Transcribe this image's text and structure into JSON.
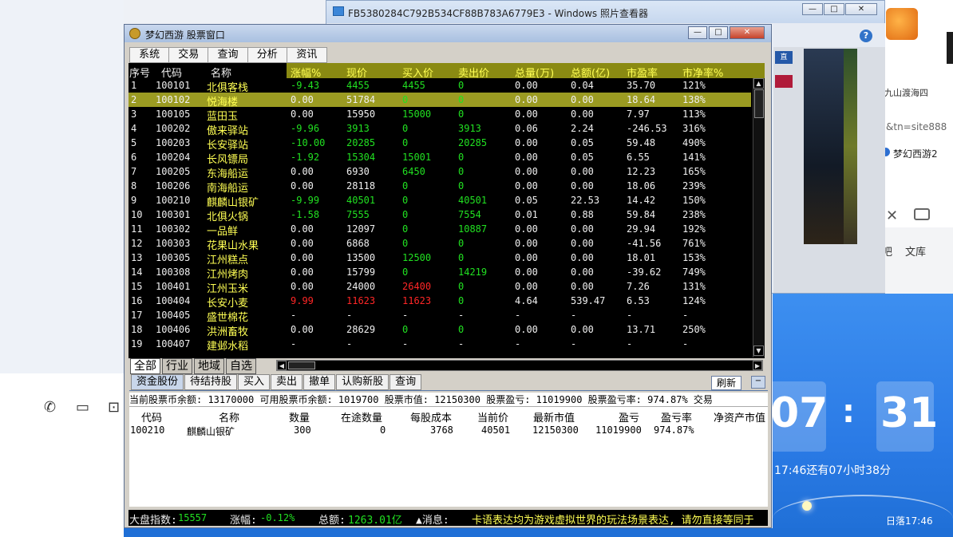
{
  "photo_viewer": {
    "title": "FB5380284C792B534CF88B783A6779E3 - Windows 照片查看器",
    "help": "?",
    "side_chip": "直",
    "buttons": {
      "minimize": "—",
      "maximize": "□",
      "close": "✕"
    }
  },
  "browser_fragment": {
    "url": "&tn=site888",
    "tab": "梦幻西游2",
    "wenku": "文库",
    "ba": "吧",
    "side_text": "九山渡海四"
  },
  "clock": {
    "hour": "07",
    "colon": ":",
    "minute": "31",
    "remaining": "17:46还有07小时38分",
    "sunset": "日落17:46"
  },
  "stock_window": {
    "title": "梦幻西游 股票窗口",
    "menu": [
      "系统",
      "交易",
      "查询",
      "分析",
      "资讯"
    ],
    "columns": {
      "seq": "序号",
      "code": "代码",
      "name": "名称",
      "change": "涨幅%",
      "price": "现价",
      "bid": "买入价",
      "ask": "卖出价",
      "vol": "总量(万)",
      "amount": "总额(亿)",
      "pe": "市盈率",
      "pb": "市净率%"
    },
    "rows": [
      {
        "seq": "1",
        "code": "100101",
        "name": "北俱客栈",
        "change": "-9.43",
        "price": "4455",
        "bid": "4455",
        "ask": "0",
        "vol": "0.00",
        "amount": "0.04",
        "pe": "35.70",
        "pb": "121%",
        "tone": "g"
      },
      {
        "seq": "2",
        "code": "100102",
        "name": "悦海楼",
        "change": "0.00",
        "price": "51784",
        "bid": "0",
        "ask": "0",
        "vol": "0.00",
        "amount": "0.00",
        "pe": "18.64",
        "pb": "138%",
        "tone": "w"
      },
      {
        "seq": "3",
        "code": "100105",
        "name": "蓝田玉",
        "change": "0.00",
        "price": "15950",
        "bid": "15000",
        "ask": "0",
        "vol": "0.00",
        "amount": "0.00",
        "pe": "7.97",
        "pb": "113%",
        "tone": "w"
      },
      {
        "seq": "4",
        "code": "100202",
        "name": "傲来驿站",
        "change": "-9.96",
        "price": "3913",
        "bid": "0",
        "ask": "3913",
        "vol": "0.06",
        "amount": "2.24",
        "pe": "-246.53",
        "pb": "316%",
        "tone": "g"
      },
      {
        "seq": "5",
        "code": "100203",
        "name": "长安驿站",
        "change": "-10.00",
        "price": "20285",
        "bid": "0",
        "ask": "20285",
        "vol": "0.00",
        "amount": "0.05",
        "pe": "59.48",
        "pb": "490%",
        "tone": "g"
      },
      {
        "seq": "6",
        "code": "100204",
        "name": "长风镖局",
        "change": "-1.92",
        "price": "15304",
        "bid": "15001",
        "ask": "0",
        "vol": "0.00",
        "amount": "0.05",
        "pe": "6.55",
        "pb": "141%",
        "tone": "g"
      },
      {
        "seq": "7",
        "code": "100205",
        "name": "东海船运",
        "change": "0.00",
        "price": "6930",
        "bid": "6450",
        "ask": "0",
        "vol": "0.00",
        "amount": "0.00",
        "pe": "12.23",
        "pb": "165%",
        "tone": "w"
      },
      {
        "seq": "8",
        "code": "100206",
        "name": "南海船运",
        "change": "0.00",
        "price": "28118",
        "bid": "0",
        "ask": "0",
        "vol": "0.00",
        "amount": "0.00",
        "pe": "18.06",
        "pb": "239%",
        "tone": "w"
      },
      {
        "seq": "9",
        "code": "100210",
        "name": "麒麟山银矿",
        "change": "-9.99",
        "price": "40501",
        "bid": "0",
        "ask": "40501",
        "vol": "0.05",
        "amount": "22.53",
        "pe": "14.42",
        "pb": "150%",
        "tone": "g"
      },
      {
        "seq": "10",
        "code": "100301",
        "name": "北俱火锅",
        "change": "-1.58",
        "price": "7555",
        "bid": "0",
        "ask": "7554",
        "vol": "0.01",
        "amount": "0.88",
        "pe": "59.84",
        "pb": "238%",
        "tone": "g"
      },
      {
        "seq": "11",
        "code": "100302",
        "name": "一品鲜",
        "change": "0.00",
        "price": "12097",
        "bid": "0",
        "ask": "10887",
        "vol": "0.00",
        "amount": "0.00",
        "pe": "29.94",
        "pb": "192%",
        "tone": "w"
      },
      {
        "seq": "12",
        "code": "100303",
        "name": "花果山水果",
        "change": "0.00",
        "price": "6868",
        "bid": "0",
        "ask": "0",
        "vol": "0.00",
        "amount": "0.00",
        "pe": "-41.56",
        "pb": "761%",
        "tone": "w"
      },
      {
        "seq": "13",
        "code": "100305",
        "name": "江州糕点",
        "change": "0.00",
        "price": "13500",
        "bid": "12500",
        "ask": "0",
        "vol": "0.00",
        "amount": "0.00",
        "pe": "18.01",
        "pb": "153%",
        "tone": "w"
      },
      {
        "seq": "14",
        "code": "100308",
        "name": "江州烤肉",
        "change": "0.00",
        "price": "15799",
        "bid": "0",
        "ask": "14219",
        "vol": "0.00",
        "amount": "0.00",
        "pe": "-39.62",
        "pb": "749%",
        "tone": "w"
      },
      {
        "seq": "15",
        "code": "100401",
        "name": "江州玉米",
        "change": "0.00",
        "price": "24000",
        "bid": "26400",
        "ask": "0",
        "vol": "0.00",
        "amount": "0.00",
        "pe": "7.26",
        "pb": "131%",
        "tone": "w",
        "bid_red": true
      },
      {
        "seq": "16",
        "code": "100404",
        "name": "长安小麦",
        "change": "9.99",
        "price": "11623",
        "bid": "11623",
        "ask": "0",
        "vol": "4.64",
        "amount": "539.47",
        "pe": "6.53",
        "pb": "124%",
        "tone": "r"
      },
      {
        "seq": "17",
        "code": "100405",
        "name": "盛世棉花",
        "change": "-",
        "price": "-",
        "bid": "-",
        "ask": "-",
        "vol": "-",
        "amount": "-",
        "pe": "-",
        "pb": "-",
        "tone": "w"
      },
      {
        "seq": "18",
        "code": "100406",
        "name": "洪洲畜牧",
        "change": "0.00",
        "price": "28629",
        "bid": "0",
        "ask": "0",
        "vol": "0.00",
        "amount": "0.00",
        "pe": "13.71",
        "pb": "250%",
        "tone": "w"
      },
      {
        "seq": "19",
        "code": "100407",
        "name": "建邺水稻",
        "change": "-",
        "price": "-",
        "bid": "-",
        "ask": "-",
        "vol": "-",
        "amount": "-",
        "pe": "-",
        "pb": "-",
        "tone": "w"
      }
    ],
    "selected_row": 2,
    "category_tabs": [
      "全部",
      "行业",
      "地域",
      "自选"
    ],
    "trade_tabs": [
      "资金股份",
      "待结持股",
      "买入",
      "卖出",
      "撤单",
      "认购新股",
      "查询"
    ],
    "refresh": "刷新",
    "collapse": "−",
    "summary": "当前股票币余额: 13170000  可用股票币余额: 1019700  股票市值: 12150300  股票盈亏: 11019900  股票盈亏率: 974.87%  交易",
    "holdings_columns": [
      "代码",
      "名称",
      "数量",
      "在途数量",
      "每股成本",
      "当前价",
      "最新市值",
      "盈亏",
      "盈亏率",
      "净资产市值"
    ],
    "holdings": [
      {
        "code": "100210",
        "name": "麒麟山银矿",
        "qty": "300",
        "transit": "0",
        "cost": "3768",
        "price": "40501",
        "value": "12150300",
        "pnl": "11019900",
        "pnl_rate": "974.87%",
        "nav": ""
      }
    ],
    "ticker": {
      "index_label": "大盘指数:",
      "index_value": "15557",
      "change_label": "涨幅:",
      "change_value": "-0.12%",
      "amount_label": "总额:",
      "amount_value": "1263.01亿",
      "msg_label": "▲消息:",
      "msg_text": "卡语表达均为游戏虚拟世界的玩法场景表达, 请勿直接等同于"
    },
    "colors": {
      "selected_row": "#9b9b22",
      "header": "#8a8a12",
      "up": "#ff2626",
      "down": "#21e021",
      "flat": "#f0f0f0",
      "name": "#ffff54"
    }
  }
}
